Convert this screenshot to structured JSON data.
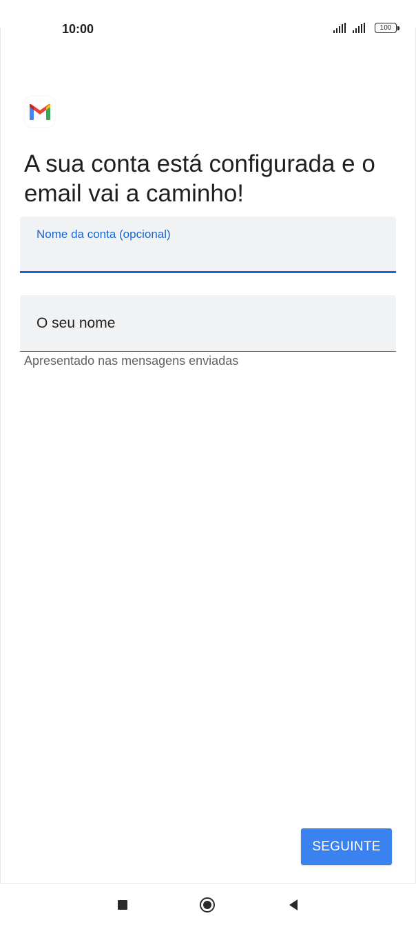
{
  "status_bar": {
    "time": "10:00",
    "battery_level": "100",
    "icons": [
      "signal-icon",
      "signal-icon",
      "battery-icon"
    ]
  },
  "app": {
    "logo_icon": "gmail-icon"
  },
  "main": {
    "heading": "A sua conta está configurada e o email vai a caminho!",
    "account_name_field": {
      "label": "Nome da conta (opcional)",
      "value": ""
    },
    "your_name_field": {
      "placeholder": "O seu nome",
      "value": "",
      "helper": "Apresentado nas mensagens enviadas"
    },
    "next_button_label": "SEGUINTE"
  },
  "navigation_bar": {
    "icons": [
      "recents-icon",
      "home-icon",
      "back-icon"
    ]
  },
  "colors": {
    "accent": "#1a66d1",
    "button": "#3b82f1",
    "field_bg": "#f1f2f4"
  }
}
